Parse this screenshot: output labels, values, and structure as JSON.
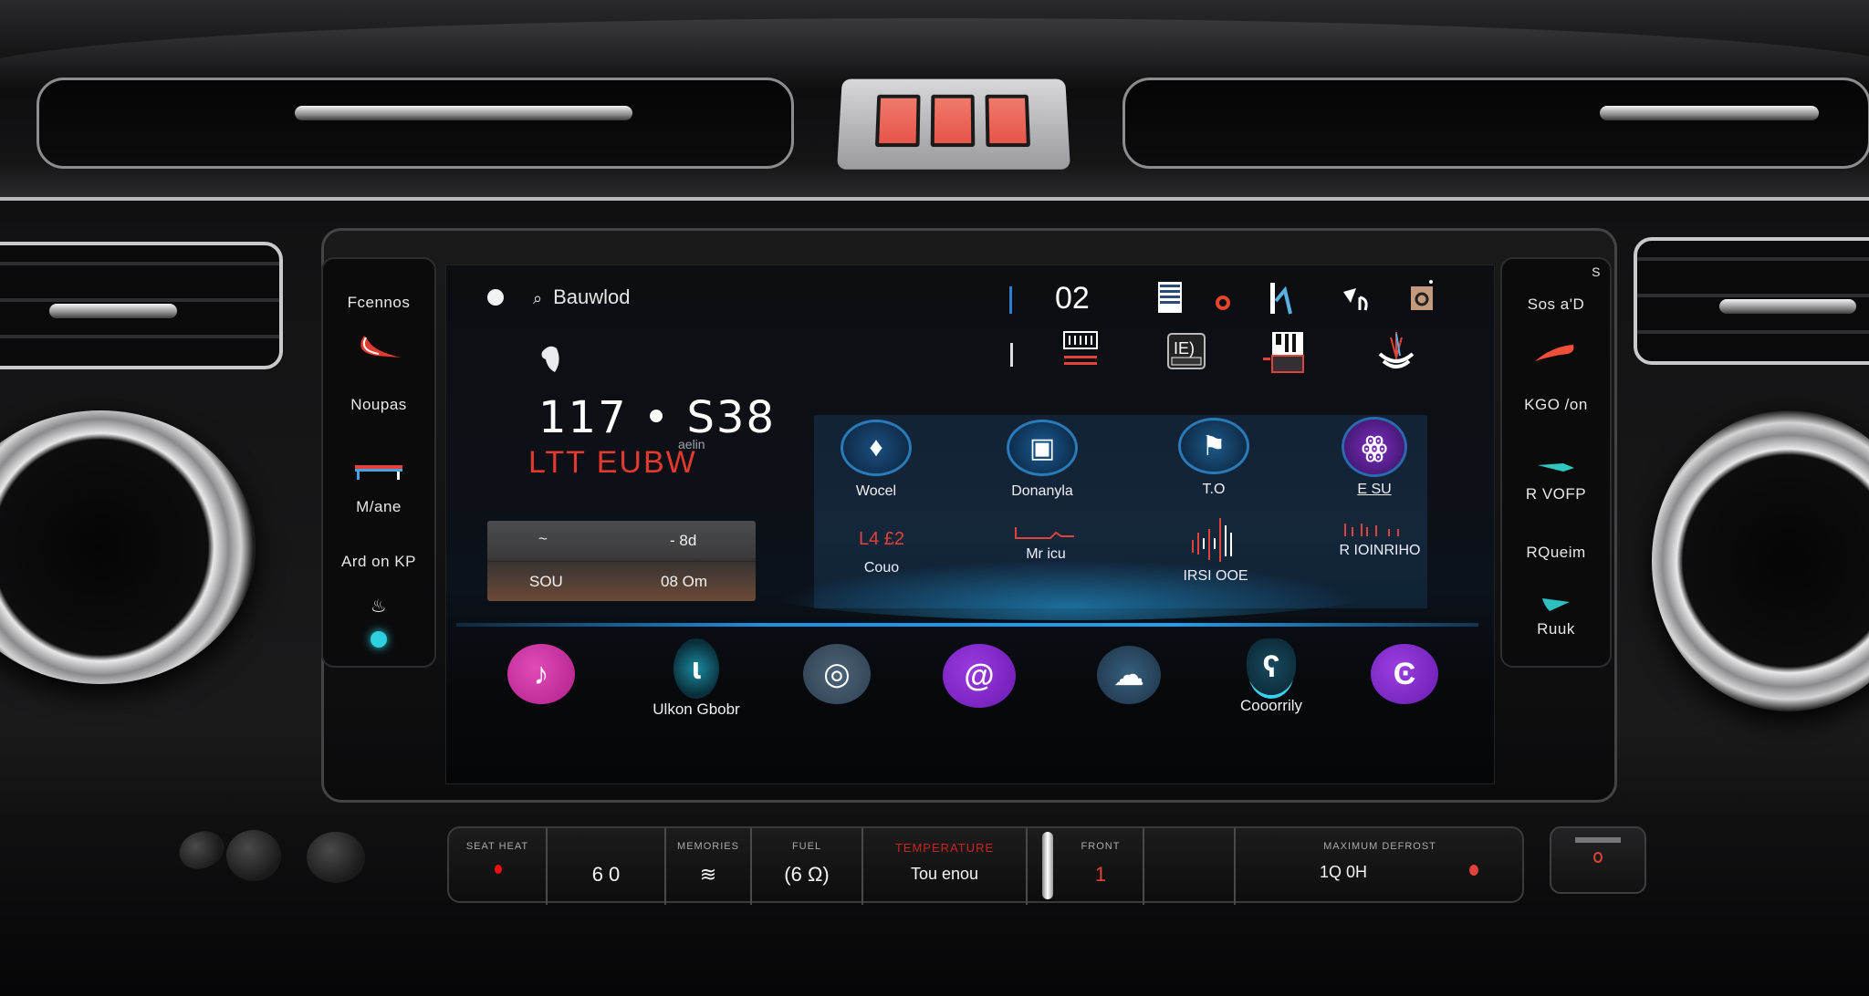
{
  "hazard": {
    "segments": 3,
    "color": "#ef6c5e"
  },
  "left_panel": {
    "items": [
      {
        "label": "Fcennos",
        "icon": "swoosh-icon",
        "icon_color": "#e33b31"
      },
      {
        "label": "Noupas",
        "icon": "",
        "icon_color": ""
      },
      {
        "label": "M/ane",
        "icon": "temperature-bar-icon",
        "icon_color": "#e0433a"
      },
      {
        "label": "Ard on KP",
        "icon": "fan-icon",
        "icon_color": "#ffffff"
      }
    ],
    "indicator_color": "#2fd0e0"
  },
  "right_panel": {
    "top_glyph": "S",
    "items": [
      {
        "label": "Sos a'D",
        "icon": "red-swoosh-icon",
        "icon_color": "#f0503a"
      },
      {
        "label": "KGO /on",
        "icon": "",
        "icon_color": ""
      },
      {
        "label": "R VOFP",
        "icon": "teal-arrow-icon",
        "icon_color": "#2ec8c0"
      },
      {
        "label": "RQueim",
        "icon": "teal-wing-icon",
        "icon_color": "#2ec0c0"
      },
      {
        "label": "Ruuk",
        "icon": "",
        "icon_color": ""
      }
    ]
  },
  "status": {
    "source_label": "Bauwlod",
    "clock": "117 • S38",
    "clock_sub": "aelin",
    "caption": "LTT EUBW",
    "accent_red": "#e23a2e"
  },
  "info_card": {
    "rows": [
      {
        "left": "~",
        "right": "- 8d"
      },
      {
        "left": "SOU",
        "right": "08 Om"
      }
    ]
  },
  "top_icons": {
    "number": "02",
    "row1": [
      "list-icon",
      "red-phone-icon",
      "signal-icon",
      "share-icon",
      "media-card-icon"
    ],
    "row2": [
      "radio-icon",
      "display-icon",
      "sd-card-icon",
      "broadcast-icon"
    ]
  },
  "app_tiles": [
    {
      "label": "Wocel",
      "icon": "map-pin-icon",
      "color": "#1b4f80",
      "metric_label": "Couo",
      "metric_value": "L4 £2"
    },
    {
      "label": "Donanyla",
      "icon": "calendar-icon",
      "color": "#1a5b92",
      "metric_label": "Mr icu",
      "metric_value": ""
    },
    {
      "label": "T.O",
      "icon": "flag-icon",
      "color": "#1c5a8a",
      "metric_label": "IRSI OOE",
      "metric_value": ""
    },
    {
      "label": "E SU",
      "icon": "profile-icon",
      "color": "#5a2a8a",
      "metric_label": "R IOINRIHO",
      "metric_value": ""
    }
  ],
  "dock": [
    {
      "label": "",
      "icon": "music-icon",
      "color": "#c22c9a"
    },
    {
      "label": "Ulkon Gbobr",
      "icon": "voice-icon",
      "color": "#0f4858"
    },
    {
      "label": "",
      "icon": "phone-icon",
      "color": "#3e5266"
    },
    {
      "label": "",
      "icon": "message-icon",
      "color": "#7a2ac0"
    },
    {
      "label": "",
      "icon": "climate-icon",
      "color": "#27435e"
    },
    {
      "label": "Cooorrily",
      "icon": "person-icon",
      "color": "#0f3446"
    },
    {
      "label": "",
      "icon": "camera-icon",
      "color": "#7d2fc0"
    }
  ],
  "lower_controls": [
    {
      "caption": "SEAT HEAT",
      "value": "",
      "indicator": "#e11"
    },
    {
      "caption": "",
      "value": "6 0"
    },
    {
      "caption": "MEMORIES",
      "value": "≋"
    },
    {
      "caption": "FUEL",
      "value": "(6 Ω)"
    },
    {
      "caption": "TEMPERATURE",
      "value": "Tou enou",
      "caption_color": "#c8261c"
    },
    {
      "caption": "FRONT",
      "value": "1"
    },
    {
      "caption": "",
      "value": ""
    },
    {
      "caption": "MAXIMUM DEFROST",
      "value": "1Q 0H"
    }
  ]
}
